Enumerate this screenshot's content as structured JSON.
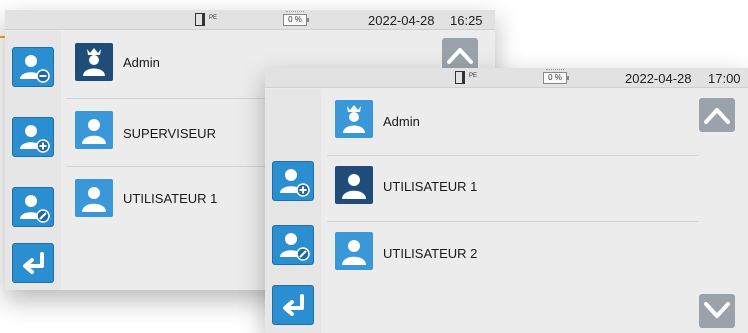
{
  "back_screen": {
    "date": "2022-04-28",
    "time": "16:25",
    "battery": "0 %",
    "users": [
      {
        "name": "Admin",
        "selected": true
      },
      {
        "name": "SUPERVISEUR",
        "selected": false
      },
      {
        "name": "UTILISATEUR 1",
        "selected": false
      }
    ],
    "sidebar_icons": [
      "user-remove-icon",
      "user-add-icon",
      "user-edit-icon",
      "back-arrow-icon"
    ],
    "scroll_icon": "chevron-up-icon"
  },
  "front_screen": {
    "date": "2022-04-28",
    "time": "17:00",
    "battery": "0 %",
    "users": [
      {
        "name": "Admin",
        "selected": false
      },
      {
        "name": "UTILISATEUR 1",
        "selected": true
      },
      {
        "name": "UTILISATEUR 2",
        "selected": false
      }
    ],
    "sidebar_icons": [
      "user-add-icon",
      "user-edit-icon",
      "back-arrow-icon"
    ],
    "scroll_icons": [
      "chevron-up-icon",
      "chevron-down-icon"
    ]
  },
  "colors": {
    "button_blue": "#2a8ed0",
    "avatar_selected": "#1f4c78",
    "avatar_normal": "#3a97d8",
    "accent": "#f5a623"
  }
}
